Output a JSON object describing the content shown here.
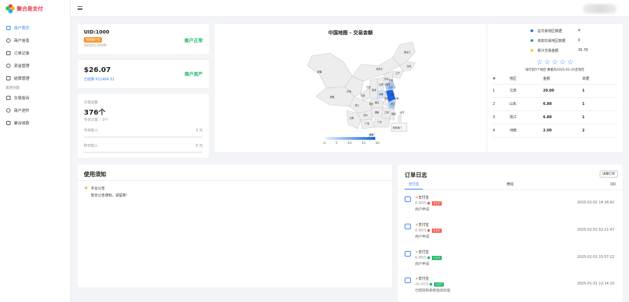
{
  "app": {
    "name": "聚合易支付"
  },
  "sidebar": {
    "items": [
      {
        "label": "商户首页",
        "icon": "home-icon"
      },
      {
        "label": "商户信息",
        "icon": "users-icon"
      },
      {
        "label": "订单记录",
        "icon": "order-icon"
      },
      {
        "label": "资金管理",
        "icon": "wallet-icon"
      },
      {
        "label": "结算管理",
        "icon": "edit-icon"
      }
    ],
    "group_label": "其他功能",
    "items2": [
      {
        "label": "交易投诉",
        "icon": "complaint-icon"
      },
      {
        "label": "商户进件",
        "icon": "settings-icon"
      },
      {
        "label": "聚合收款",
        "icon": "qrcode-icon"
      }
    ]
  },
  "account": {
    "uid": "UID:1000",
    "tag": "到期商户号",
    "note": "您的会员已经到期",
    "status": "账户正常"
  },
  "balance": {
    "amount": "$26.07",
    "settled": "已结算:¥11404.32",
    "label": "商户资产"
  },
  "orders": {
    "label": "订单总数",
    "count": "376个",
    "today_orders": "今日订单：  0个",
    "today_income_label": "今日收入",
    "today_income_value": "0 元",
    "yesterday_income_label": "昨日收入",
    "yesterday_income_value": "0 元",
    "today_income_pct": 0,
    "yesterday_income_pct": 0
  },
  "map": {
    "title": "中国地图 - 交易金额",
    "scale": [
      "0",
      "5",
      "10",
      "15",
      "20"
    ],
    "labels": [
      "黑龙江",
      "吉林",
      "辽宁",
      "内蒙古",
      "北京",
      "天津",
      "河北",
      "山西",
      "山东",
      "江苏",
      "上海",
      "浙江",
      "安徽",
      "河南",
      "湖北",
      "陕西",
      "宁夏",
      "甘肃",
      "青海",
      "新疆",
      "西藏",
      "四川",
      "重庆",
      "贵州",
      "云南",
      "广西",
      "广东",
      "湖南",
      "江西",
      "福建",
      "台湾",
      "香港澳门",
      "海南"
    ]
  },
  "stats": {
    "legend": [
      {
        "label": "总交易地区数据",
        "value": "4",
        "color": "#2c6df5"
      },
      {
        "label": "未知交易地区数据",
        "value": "0",
        "color": "#18b566"
      },
      {
        "label": "累计交易金额",
        "value": "35.76",
        "color": "#f7c948"
      }
    ],
    "rank_caption": "排行前5个地区 数据为2025-01-31至现在",
    "star_count": 5,
    "columns": [
      "#",
      "地区",
      "金额",
      "单据"
    ],
    "rows": [
      {
        "rank": "1",
        "region": "江苏",
        "amount": "20.00",
        "count": "1"
      },
      {
        "rank": "2",
        "region": "山东",
        "amount": "6.88",
        "count": "1"
      },
      {
        "rank": "3",
        "region": "浙江",
        "amount": "6.88",
        "count": "1"
      },
      {
        "rank": "4",
        "region": "河南",
        "amount": "2.00",
        "count": "2"
      }
    ]
  },
  "notice": {
    "title": "使用须知",
    "item_title": "平台公告",
    "item_text": "暂无公告通知，请留意!"
  },
  "log": {
    "title": "订单日志",
    "detail_btn": "详细订单",
    "tabs": [
      "支付宝",
      "微信",
      "QQ"
    ],
    "entries": [
      {
        "channel": "支付宝",
        "amount": "6.88元",
        "status": "未支付",
        "status_color": "#f05a4f",
        "desc": "商户申请",
        "time": "2025-02-02 14:16:42"
      },
      {
        "channel": "支付宝",
        "amount": "6.88元",
        "status": "未支付",
        "status_color": "#f05a4f",
        "desc": "商户申请",
        "time": "2025-02-02 02:21:47"
      },
      {
        "channel": "支付宝",
        "amount": "6.88元",
        "status": "已支付",
        "status_color": "#18b566",
        "desc": "商户申请",
        "time": "2025-02-01 15:57:22"
      },
      {
        "channel": "支付宝",
        "amount": "20.00元",
        "status": "已支付",
        "status_color": "#18b566",
        "desc": "已经授权系统自动充值",
        "time": "2025-01-31 22:14:10"
      }
    ]
  }
}
